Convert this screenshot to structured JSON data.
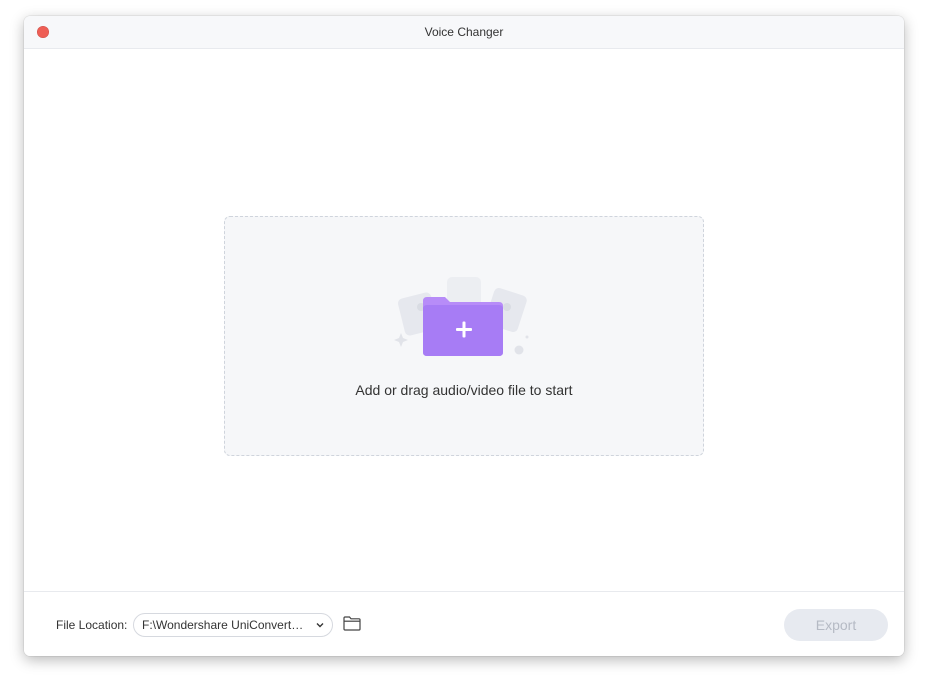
{
  "window": {
    "title": "Voice Changer"
  },
  "dropzone": {
    "prompt": "Add or drag audio/video file to start"
  },
  "footer": {
    "file_location_label": "File Location:",
    "file_location_value": "F:\\Wondershare UniConverte...",
    "export_label": "Export"
  },
  "colors": {
    "close_button": "#ee5e55",
    "folder_accent": "#a77cf5",
    "export_disabled_bg": "#e7eaf0",
    "export_disabled_text": "#b5bac4"
  },
  "icons": {
    "close": "close-icon",
    "add_file_folder": "add-folder-icon",
    "dropdown": "chevron-down-icon",
    "browse_folder": "folder-icon"
  }
}
